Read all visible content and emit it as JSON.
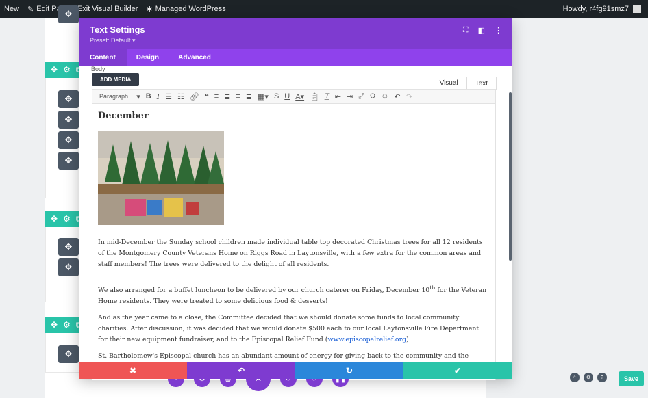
{
  "adminbar": {
    "new_label": "New",
    "edit_page_label": "Edit Page",
    "exit_vb_label": "Exit Visual Builder",
    "managed_wp_label": "Managed WordPress",
    "howdy_label": "Howdy, r4fg91smz7"
  },
  "modal": {
    "title": "Text Settings",
    "preset": "Preset: Default ▾",
    "tabs": [
      "Content",
      "Design",
      "Advanced"
    ],
    "body_label": "Body",
    "add_media": "ADD MEDIA",
    "editor_tabs": [
      "Visual",
      "Text"
    ],
    "paragraph_select": "Paragraph"
  },
  "content": {
    "heading": "December",
    "p1": "In mid-December the Sunday school children made individual table top decorated Christmas trees for all 12 residents of the Montgomery County Veterans Home on Riggs Road in Laytonsville, with a few extra for the common areas and staff members! The trees were delivered to the delight of all residents.",
    "p2_pre": "We also arranged for a buffet luncheon to be delivered by our church caterer on Friday, December 10",
    "p2_sup": "th",
    "p2_post": " for the Veteran Home residents. They were treated to some delicious food & desserts!",
    "p3_pre": "And as the year came to a close, the Committee decided that we should donate some funds to local community charities. After discussion, it was decided that we would donate $500 each to our local Laytonsville Fire Department for their new equipment fundraiser, and to the Episcopal Relief Fund (",
    "p3_link": "www.episcopalrelief.org",
    "p3_post": ")",
    "p4": "St. Bartholomew's Episcopal church has an abundant amount of energy for giving back to the community and the world! We are"
  },
  "save_label": "Save",
  "colors": {
    "purple": "#7e3bd0",
    "teal": "#29c4a9",
    "red": "#ef5555",
    "blue": "#2b87da"
  }
}
